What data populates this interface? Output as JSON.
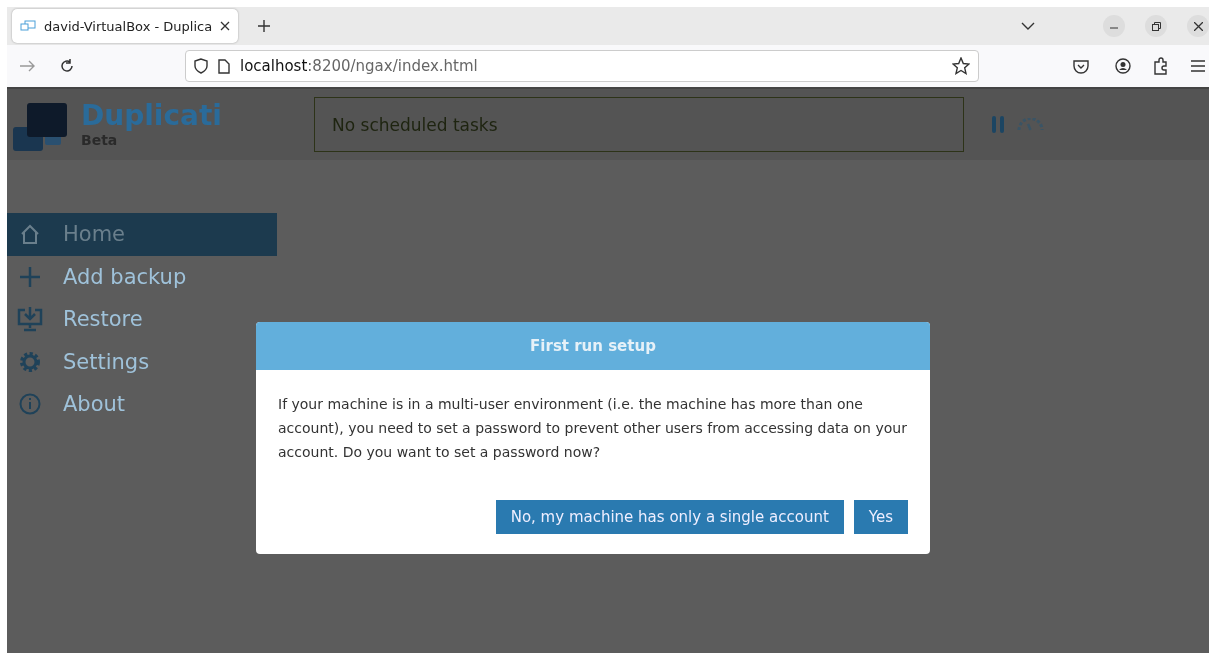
{
  "browser": {
    "tabs": [
      {
        "title": "david-VirtualBox - Duplica",
        "selected": true
      }
    ],
    "url_host": "localhost",
    "url_path": ":8200/ngax/index.html"
  },
  "app": {
    "logo": {
      "name": "Duplicati",
      "subtitle": "Beta"
    },
    "status": "No scheduled tasks",
    "nav": [
      {
        "label": "Home",
        "selected": true
      },
      {
        "label": "Add backup",
        "selected": false
      },
      {
        "label": "Restore",
        "selected": false
      },
      {
        "label": "Settings",
        "selected": false
      },
      {
        "label": "About",
        "selected": false
      }
    ]
  },
  "dialog": {
    "title": "First run setup",
    "message": "If your machine is in a multi-user environment (i.e. the machine has more than one account), you need to set a password to prevent other users from accessing data on your account. Do you want to set a password now?",
    "buttons": [
      "No, my machine has only a single account",
      "Yes"
    ]
  }
}
